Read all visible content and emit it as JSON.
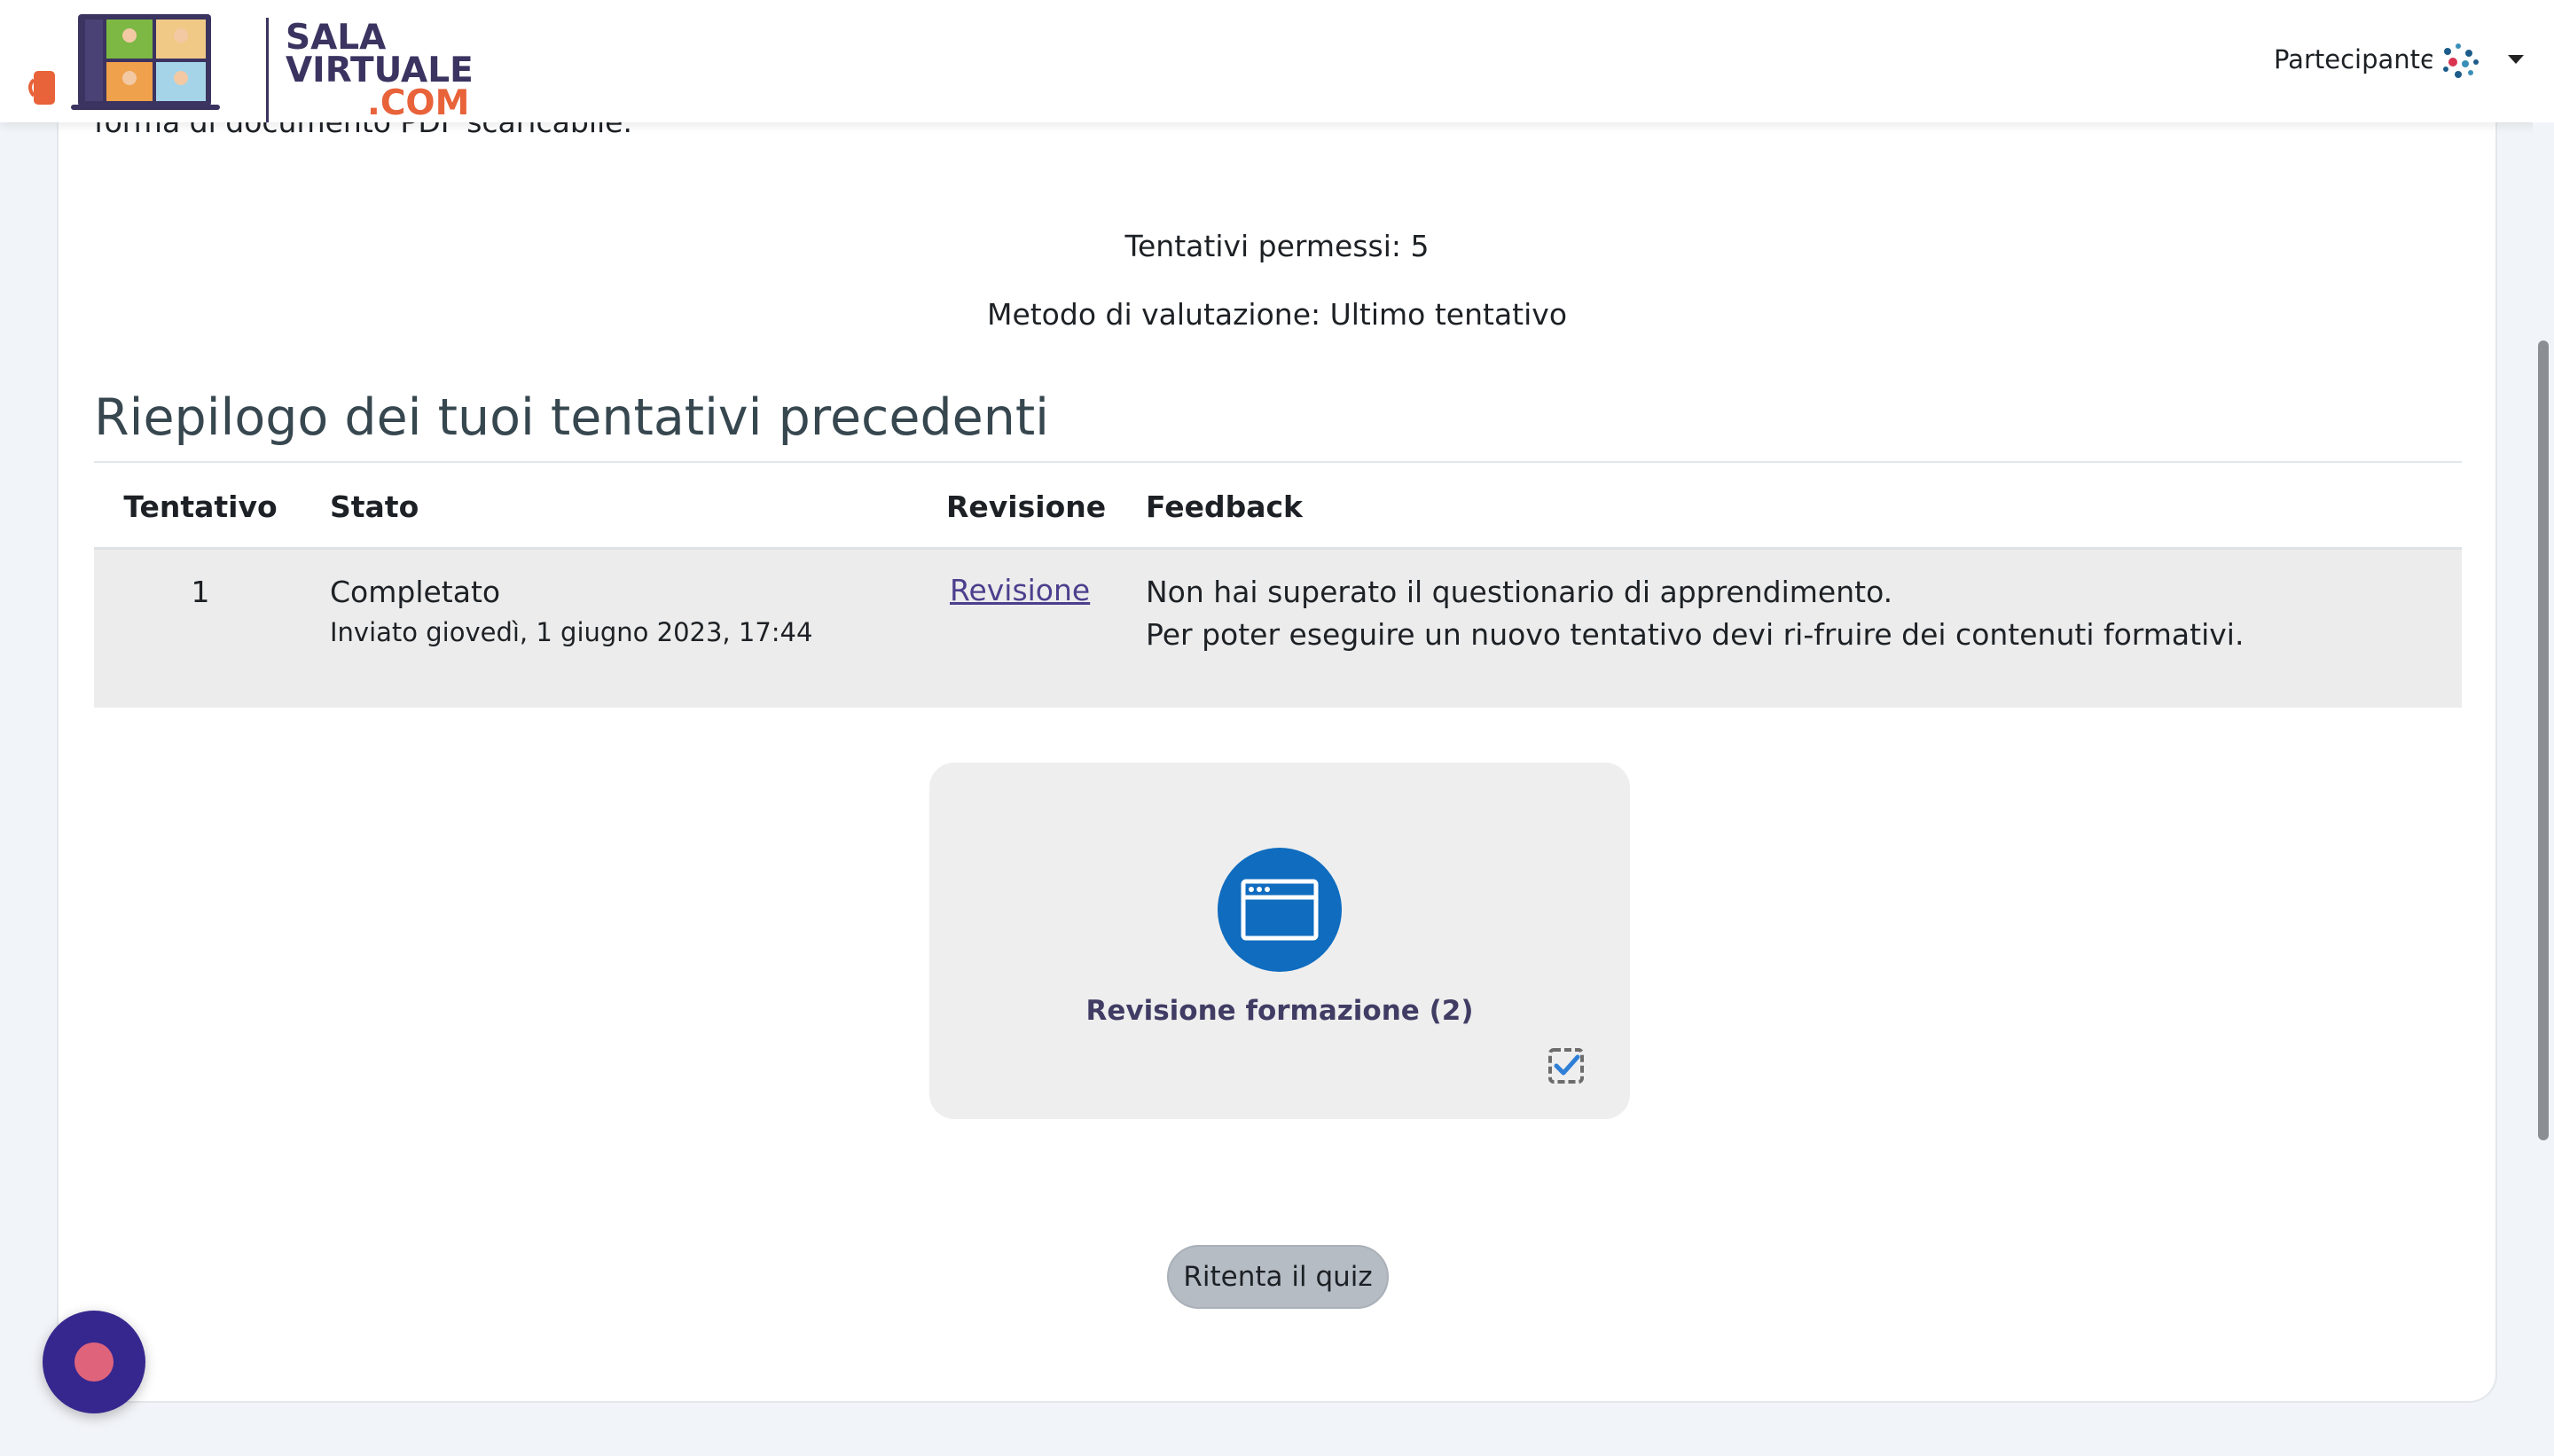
{
  "header": {
    "logo_text_line1": "SALA",
    "logo_text_line2": "VIRTUALE",
    "logo_text_line3": ".COM",
    "user_role": "Partecipante"
  },
  "quiz_info": {
    "intro_text": "forma di documento PDF scaricabile.",
    "attempts_allowed": "Tentativi permessi: 5",
    "grading_method": "Metodo di valutazione: Ultimo tentativo"
  },
  "summary": {
    "title": "Riepilogo dei tuoi tentativi precedenti",
    "columns": [
      "Tentativo",
      "Stato",
      "Revisione",
      "Feedback"
    ],
    "rows": [
      {
        "attempt": "1",
        "state": "Completato",
        "submitted": "Inviato giovedì, 1 giugno 2023, 17:44",
        "review_link": "Revisione",
        "feedback_line1": "Non hai superato il questionario di apprendimento.",
        "feedback_line2": "Per poter eseguire un nuovo tentativo devi ri-fruire dei contenuti formativi."
      }
    ]
  },
  "activity": {
    "title": "Revisione formazione (2)",
    "icon": "browser-window-icon",
    "completion_icon": "checkbox-check-icon"
  },
  "actions": {
    "retry_label": "Ritenta il quiz"
  },
  "colors": {
    "activity_icon_bg": "#0f6cbf",
    "brand_dark": "#3b3360",
    "brand_orange": "#e8623a",
    "fab_bg": "#36278f",
    "fab_dot": "#e0637c"
  }
}
